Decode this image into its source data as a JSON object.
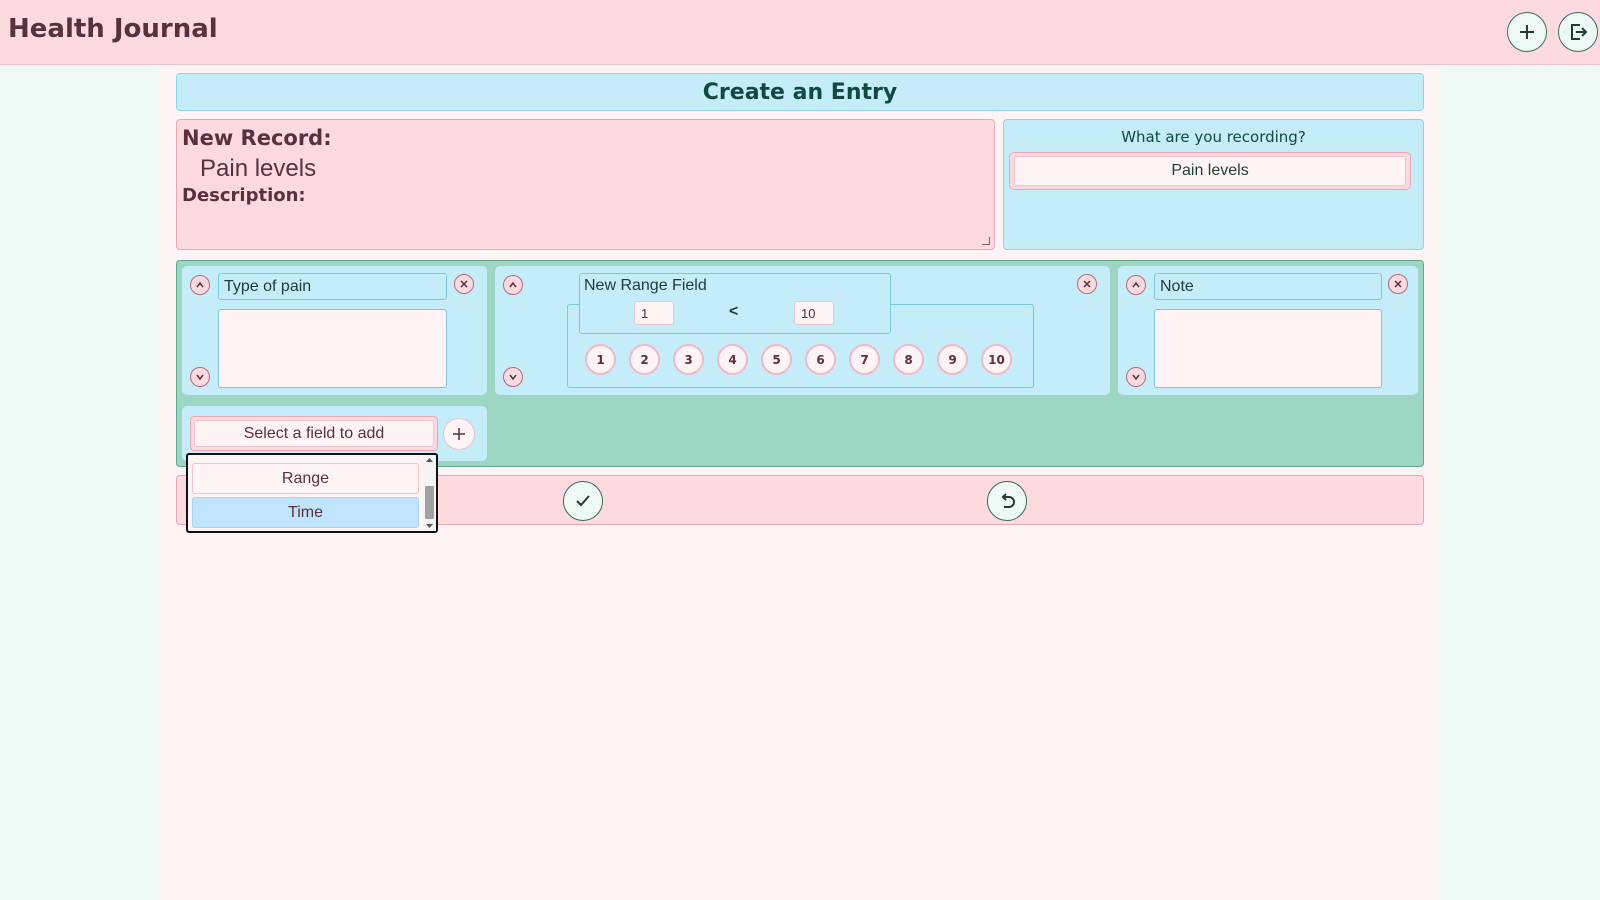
{
  "app": {
    "title": "Health Journal"
  },
  "topbar": {
    "add_button": "add",
    "logout_button": "logout"
  },
  "page": {
    "title": "Create an Entry"
  },
  "record": {
    "label": "New Record:",
    "name": "Pain levels",
    "description_label": "Description:"
  },
  "recording": {
    "question": "What are you recording?",
    "value": "Pain levels"
  },
  "fields": [
    {
      "name": "Type of pain",
      "kind": "text"
    },
    {
      "name": "New Range Field",
      "kind": "range",
      "min": "1",
      "max": "10",
      "separator": "<",
      "values": [
        "1",
        "2",
        "3",
        "4",
        "5",
        "6",
        "7",
        "8",
        "9",
        "10"
      ]
    },
    {
      "name": "Note",
      "kind": "text"
    }
  ],
  "add_field": {
    "placeholder": "Select a field to add",
    "options": [
      {
        "label": "Range",
        "highlighted": false
      },
      {
        "label": "Time",
        "highlighted": true
      }
    ]
  },
  "colors": {
    "pink": "#fcdae0",
    "light_blue": "#c4ecf9",
    "green": "#9dd6c3",
    "dark_text": "#5a2f3e",
    "teal_text": "#0e4a40",
    "highlight": "#bfe4fb"
  }
}
